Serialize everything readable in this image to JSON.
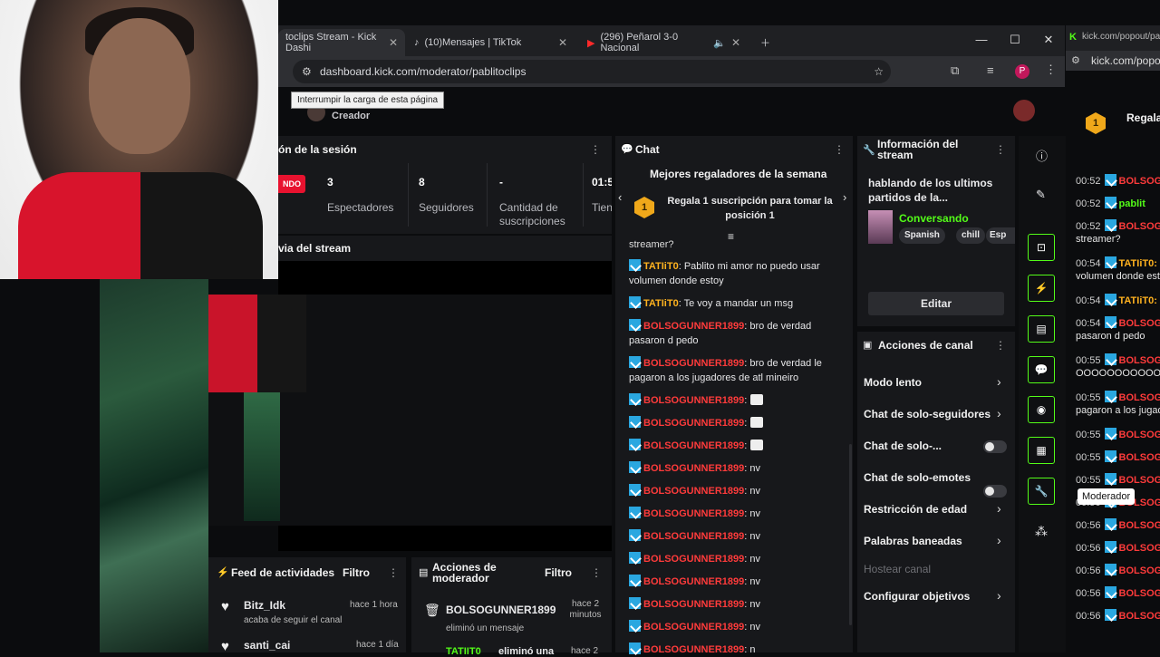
{
  "browser": {
    "tabs": [
      {
        "label": "toclips Stream - Kick Dashi"
      },
      {
        "label": "(10)Mensajes | TikTok"
      },
      {
        "label": "(296) Peñarol 3-0 Nacional"
      }
    ],
    "url": "dashboard.kick.com/moderator/pablitoclips",
    "tooltip": "Interrumpir la carga de esta página",
    "profile_initial": "P",
    "popout_url_tab": "kick.com/popout/pa",
    "popout_url": "kick.com/popout/"
  },
  "header": {
    "role": "Creador"
  },
  "session": {
    "title": "ón de la sesión",
    "live_badge": "NDO",
    "stats": [
      {
        "value": "3",
        "label": "Espectadores"
      },
      {
        "value": "8",
        "label": "Seguidores"
      },
      {
        "value": "-",
        "label": "Cantidad de suscripciones"
      },
      {
        "value": "01:5",
        "label": "Tien"
      }
    ]
  },
  "preview": {
    "title": "via del stream"
  },
  "activity": {
    "title": "Feed de actividades",
    "filter": "Filtro",
    "items": [
      {
        "user": "Bitz_Idk",
        "time": "hace 1 hora",
        "text": "acaba de seguir el canal"
      },
      {
        "user": "santi_cai",
        "time": "hace 1 día",
        "text": ""
      }
    ]
  },
  "modactions": {
    "title": "Acciones de moderador",
    "filter": "Filtro",
    "items": [
      {
        "user": "BOLSOGUNNER1899",
        "time": "hace 2 minutos",
        "text": "eliminó un mensaje"
      },
      {
        "user": "TATIIT0",
        "time": "hace 2",
        "text": "eliminó una"
      }
    ]
  },
  "chat": {
    "title": "Chat",
    "gifters_title": "Mejores regaladores de la semana",
    "gifters_text": "Regala 1 suscripción para tomar la posición 1",
    "gifters_rank": "1",
    "first_line": "streamer?",
    "messages": [
      {
        "user": "TATIiT0",
        "text": ": Pablito mi amor no puedo usar volumen donde estoy",
        "color": "yel"
      },
      {
        "user": "TATIiT0",
        "text": ": Te voy a mandar un msg",
        "color": "yel"
      },
      {
        "user": "BOLSOGUNNER1899",
        "text": ": bro de verdad pasaron d pedo",
        "color": "red"
      },
      {
        "user": "BOLSOGUNNER1899",
        "text": ": bro de verdad le pagaron a los jugadores de atl mineiro",
        "color": "red"
      },
      {
        "user": "BOLSOGUNNER1899",
        "text": ":",
        "color": "red",
        "emote": true
      },
      {
        "user": "BOLSOGUNNER1899",
        "text": ":",
        "color": "red",
        "emote": true
      },
      {
        "user": "BOLSOGUNNER1899",
        "text": ":",
        "color": "red",
        "emote": true
      },
      {
        "user": "BOLSOGUNNER1899",
        "text": ": nv",
        "color": "red"
      },
      {
        "user": "BOLSOGUNNER1899",
        "text": ": nv",
        "color": "red"
      },
      {
        "user": "BOLSOGUNNER1899",
        "text": ": nv",
        "color": "red"
      },
      {
        "user": "BOLSOGUNNER1899",
        "text": ": nv",
        "color": "red"
      },
      {
        "user": "BOLSOGUNNER1899",
        "text": ": nv",
        "color": "red"
      },
      {
        "user": "BOLSOGUNNER1899",
        "text": ": nv",
        "color": "red"
      },
      {
        "user": "BOLSOGUNNER1899",
        "text": ": nv",
        "color": "red"
      },
      {
        "user": "BOLSOGUNNER1899",
        "text": ": nv",
        "color": "red"
      },
      {
        "user": "BOLSOGUNNER1899",
        "text": ": n",
        "color": "red"
      }
    ]
  },
  "streaminfo": {
    "title": "Información del stream",
    "stream_title": "hablando de los ultimos partidos de la...",
    "category": "Conversando",
    "tags": [
      "Spanish",
      "chill",
      "Esp"
    ],
    "edit": "Editar"
  },
  "channelactions": {
    "title": "Acciones de canal",
    "items": [
      {
        "label": "Modo lento",
        "kind": "chev"
      },
      {
        "label": "Chat de solo-seguidores",
        "kind": "chev"
      },
      {
        "label": "Chat de solo-...",
        "kind": "toggle"
      },
      {
        "label": "Chat de solo-emotes",
        "kind": "toggle"
      },
      {
        "label": "Restricción de edad",
        "kind": "chev"
      },
      {
        "label": "Palabras baneadas",
        "kind": "chev"
      },
      {
        "label": "Hostear canal",
        "kind": "disabled"
      },
      {
        "label": "Configurar objetivos",
        "kind": "chev"
      }
    ]
  },
  "sidebar": {
    "tooltip": "Moderador"
  },
  "popout": {
    "title": "Regala",
    "rank": "1",
    "messages": [
      {
        "time": "00:52",
        "user": "BOLSOG",
        "color": "red",
        "cont": ""
      },
      {
        "time": "00:52",
        "user": "pablit",
        "color": "grn",
        "cont": ""
      },
      {
        "time": "00:52",
        "user": "BOLSOG",
        "color": "red",
        "cont": "streamer?"
      },
      {
        "time": "00:54",
        "user": "TATIiT0:",
        "color": "yel",
        "cont": "volumen donde est"
      },
      {
        "time": "00:54",
        "user": "TATIiT0:",
        "color": "yel",
        "cont": ""
      },
      {
        "time": "00:54",
        "user": "BOLSOG",
        "color": "red",
        "cont": "pasaron d pedo"
      },
      {
        "time": "00:55",
        "user": "BOLSOG",
        "color": "red",
        "cont": "OOOOOOOOOOOO"
      },
      {
        "time": "00:55",
        "user": "BOLSOG",
        "color": "red",
        "cont": "pagaron a los jugad"
      },
      {
        "time": "00:55",
        "user": "BOLSOG",
        "color": "red",
        "cont": ""
      },
      {
        "time": "00:55",
        "user": "BOLSOG",
        "color": "red",
        "cont": ""
      },
      {
        "time": "00:55",
        "user": "BOLSOG",
        "color": "red",
        "cont": ""
      },
      {
        "time": "00:56",
        "user": "BOLSOG",
        "color": "red",
        "cont": ""
      },
      {
        "time": "00:56",
        "user": "BOLSOG",
        "color": "red",
        "cont": ""
      },
      {
        "time": "00:56",
        "user": "BOLSOG",
        "color": "red",
        "cont": ""
      },
      {
        "time": "00:56",
        "user": "BOLSOG",
        "color": "red",
        "cont": ""
      },
      {
        "time": "00:56",
        "user": "BOLSOG",
        "color": "red",
        "cont": ""
      },
      {
        "time": "00:56",
        "user": "BOLSOG",
        "color": "red",
        "cont": ""
      }
    ]
  },
  "colors": {
    "kick_green": "#53fc18",
    "user_red": "#ff3b3b",
    "user_yellow": "#ffb21f"
  }
}
